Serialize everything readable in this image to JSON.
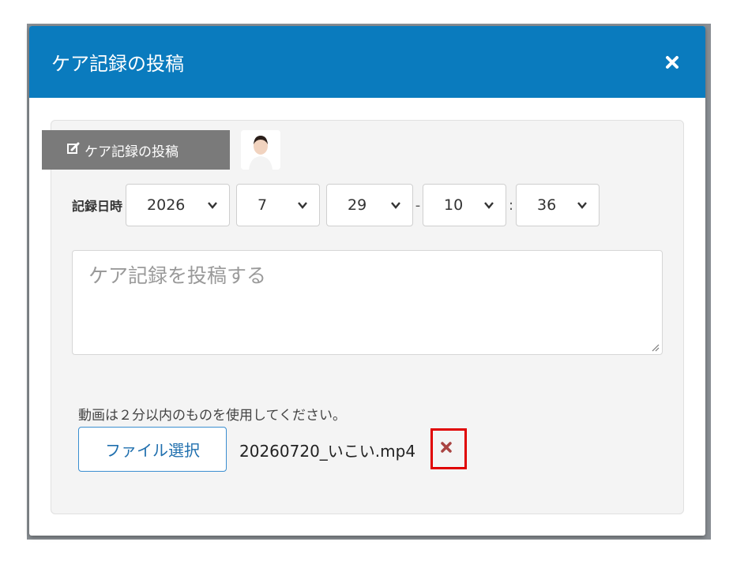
{
  "modal": {
    "title": "ケア記録の投稿",
    "close_icon": "close-icon"
  },
  "tab": {
    "label": "ケア記録の投稿",
    "icon": "edit-icon"
  },
  "date": {
    "label": "記録日時",
    "year": "2026",
    "month": "7",
    "day": "29",
    "date_time_separator": "-",
    "hour": "10",
    "time_separator": ":",
    "minute": "36"
  },
  "post": {
    "placeholder": "ケア記録を投稿する"
  },
  "upload": {
    "notice": "動画は２分以内のものを使用してください。",
    "button_label": "ファイル選択",
    "file_name": "20260720_いこい.mp4",
    "remove_icon": "remove-file-icon"
  },
  "colors": {
    "header": "#0a7bbe",
    "tab": "#7a7a7a",
    "remove_icon": "#a94442",
    "highlight": "#e00000"
  }
}
